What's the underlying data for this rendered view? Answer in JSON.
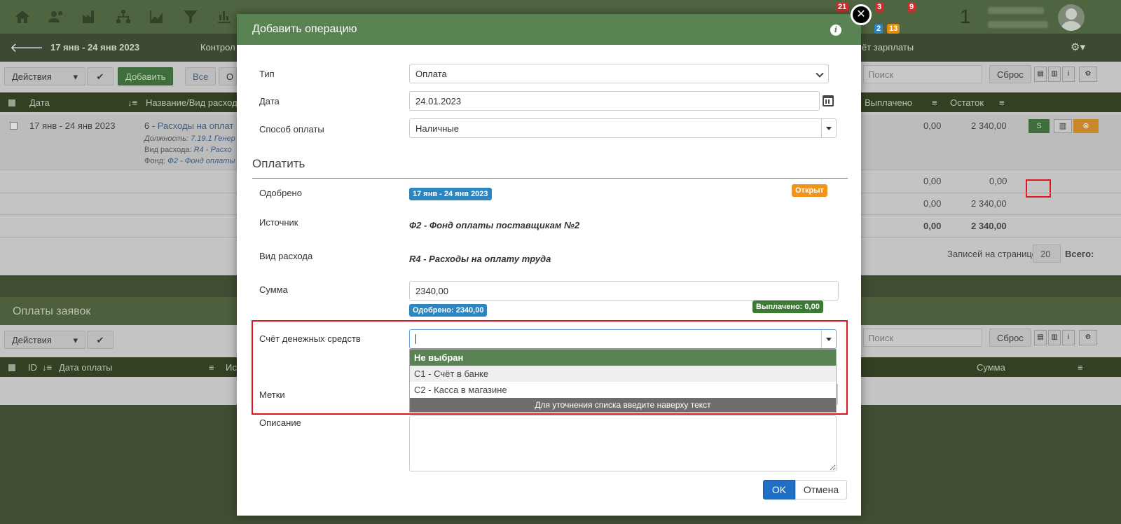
{
  "bg": {
    "period": "17 янв - 24 янв 2023",
    "tab_left": "Контрол",
    "tab_right": "ёт зарплаты",
    "badges": {
      "a": "21",
      "b": "3",
      "c": "9",
      "d": "2",
      "e": "13"
    },
    "counter": "1",
    "toolbar": {
      "actions": "Действия",
      "add": "Добавить",
      "all": "Все",
      "other": "О",
      "search_placeholder": "Поиск",
      "reset": "Сброс"
    },
    "table": {
      "col_date": "Дата",
      "col_name": "Название/Вид расхода",
      "col_paid": "Выплачено",
      "col_rest": "Остаток",
      "row_date": "17 янв - 24 янв 2023",
      "row_title_prefix": "6 - ",
      "row_title_link": "Расходы на оплат",
      "row_pos_label": "Должность:",
      "row_pos_value": "7.19.1 Генер",
      "row_kind_label": "Вид расхода:",
      "row_kind_value": "R4 - Расхо",
      "row_fund_label": "Фонд:",
      "row_fund_value": "Ф2 - Фонд оплаты",
      "row_paid": "0,00",
      "row_rest": "2 340,00",
      "sum1_paid": "0,00",
      "sum1_rest": "0,00",
      "sum2_paid": "0,00",
      "sum2_rest": "2 340,00",
      "sum3_paid": "0,00",
      "sum3_rest": "2 340,00",
      "per_page_label": "Записей на странице",
      "per_page_value": "20",
      "total_label": "Всего: "
    },
    "payments": {
      "title": "Оплаты заявок",
      "actions": "Действия",
      "col_id": "ID",
      "col_date": "Дата оплаты",
      "col_other": "Ис",
      "col_sum": "Сумма",
      "search_placeholder": "Поиск",
      "reset": "Сброс"
    }
  },
  "modal": {
    "title": "Добавить операцию",
    "close": "✕",
    "info": "i",
    "fields": {
      "type_label": "Тип",
      "type_value": "Оплата",
      "date_label": "Дата",
      "date_value": "24.01.2023",
      "method_label": "Способ оплаты",
      "method_value": "Наличные"
    },
    "section": "Оплатить",
    "approved_label": "Одобрено",
    "approved_badge": "17 янв - 24 янв 2023",
    "status_badge": "Открыт",
    "source_label": "Источник",
    "source_value": "Ф2 - Фонд оплаты поставщикам №2",
    "expense_label": "Вид расхода",
    "expense_value": "R4 - Расходы на оплату труда",
    "sum_label": "Сумма",
    "sum_value": "2340,00",
    "approved_sum": "Одобрено: 2340,00",
    "paid_sum": "Выплачено: 0,00",
    "account_label": "Счёт денежных средств",
    "dropdown": {
      "options": [
        "Не выбран",
        "С1 - Счёт в банке",
        "С2 - Касса в магазине"
      ],
      "hint": "Для уточнения списка введите наверху текст"
    },
    "tags_label": "Метки",
    "desc_label": "Описание",
    "ok": "OK",
    "cancel": "Отмена"
  },
  "colors": {
    "header_green": "#5a8353",
    "badge_blue": "#2e86c1",
    "badge_orange": "#f0941c",
    "badge_green": "#3b7a35",
    "highlight_red": "#e0141e"
  }
}
